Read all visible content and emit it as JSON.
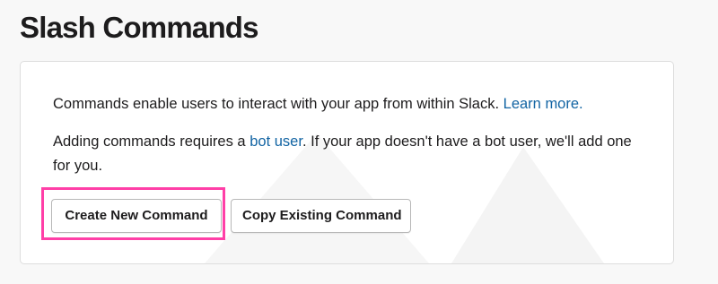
{
  "page": {
    "title": "Slash Commands"
  },
  "card": {
    "intro_text": "Commands enable users to interact with your app from within Slack.",
    "learn_more_link": "Learn more.",
    "bot_text_before": "Adding commands requires a",
    "bot_user_link": "bot user",
    "bot_text_after": ". If your app doesn't have a bot user, we'll add one for you."
  },
  "buttons": {
    "create_new": "Create New Command",
    "copy_existing": "Copy Existing Command"
  },
  "colors": {
    "link": "#1264a3",
    "highlight": "#ff3fa7",
    "title": "#1d1c1d"
  }
}
